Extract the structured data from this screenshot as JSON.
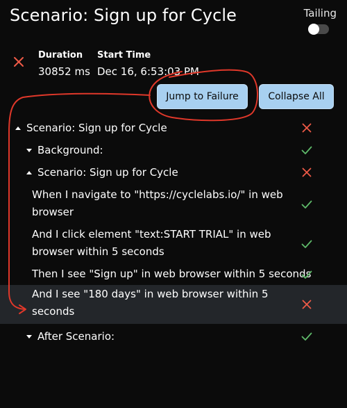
{
  "header": {
    "title": "Scenario: Sign up for Cycle",
    "tailing_label": "Tailing",
    "tailing_on": false
  },
  "summary": {
    "status_icon": "fail-x-icon",
    "duration_label": "Duration",
    "duration_value": "30852 ms",
    "start_time_label": "Start Time",
    "start_time_value": "Dec 16, 6:53:03 PM"
  },
  "toolbar": {
    "jump_label": "Jump to Failure",
    "collapse_label": "Collapse All"
  },
  "colors": {
    "pass": "#5fba6a",
    "fail": "#ef5a47",
    "button": "#a8d0f0",
    "annotation": "#e0382a"
  },
  "tree": [
    {
      "text": "Scenario: Sign up for Cycle",
      "status": "fail",
      "caret": "up"
    },
    {
      "text": "Background:",
      "status": "pass",
      "caret": "down"
    },
    {
      "text": "Scenario: Sign up for Cycle",
      "status": "fail",
      "caret": "up"
    },
    {
      "text": "When I navigate to \"https://cyclelabs.io/\" in web",
      "text2": "browser",
      "status": "pass"
    },
    {
      "text": "And I click element \"text:START TRIAL\" in web",
      "text2": "browser within 5 seconds",
      "status": "pass"
    },
    {
      "text": "Then I see \"Sign up\" in web browser within 5 seconds",
      "status": "pass"
    },
    {
      "text": "And I see \"180 days\" in web browser within 5",
      "text2": "seconds",
      "status": "fail",
      "highlighted": true
    },
    {
      "text": "After Scenario:",
      "status": "pass",
      "caret": "down"
    }
  ]
}
